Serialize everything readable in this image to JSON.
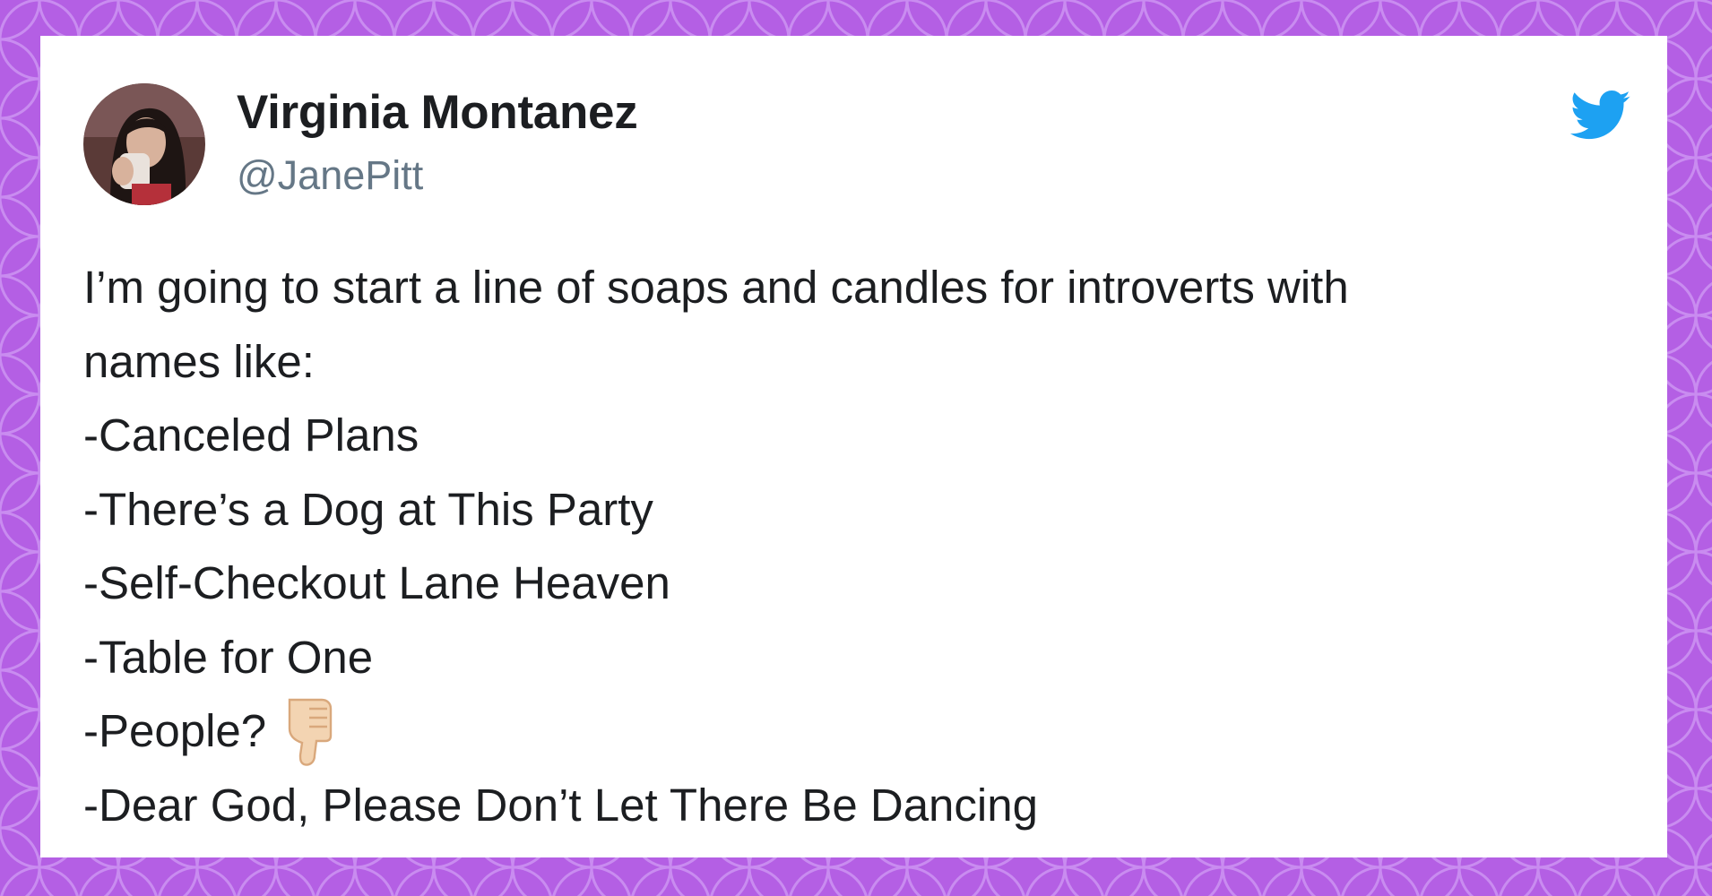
{
  "colors": {
    "background": "#b45fe4",
    "pattern": "#c98cf0",
    "card": "#ffffff",
    "name_text": "#1c1e21",
    "handle_text": "#657786",
    "twitter_blue": "#1da1f2",
    "emoji_skin": "#f3d4b2"
  },
  "tweet": {
    "author": {
      "name": "Virginia Montanez",
      "handle": "@JanePitt",
      "avatar": "profile-photo"
    },
    "brand_icon": "twitter-bird-icon",
    "lines": [
      "I’m going to start a line of soaps and candles for introverts with",
      "names like:",
      "-Canceled Plans",
      "-There’s a Dog at This Party",
      "-Self-Checkout Lane Heaven",
      "-Table for One",
      "-People?",
      "-Dear God, Please Don’t Let There Be Dancing"
    ],
    "emoji": "thumbs-down-emoji"
  }
}
